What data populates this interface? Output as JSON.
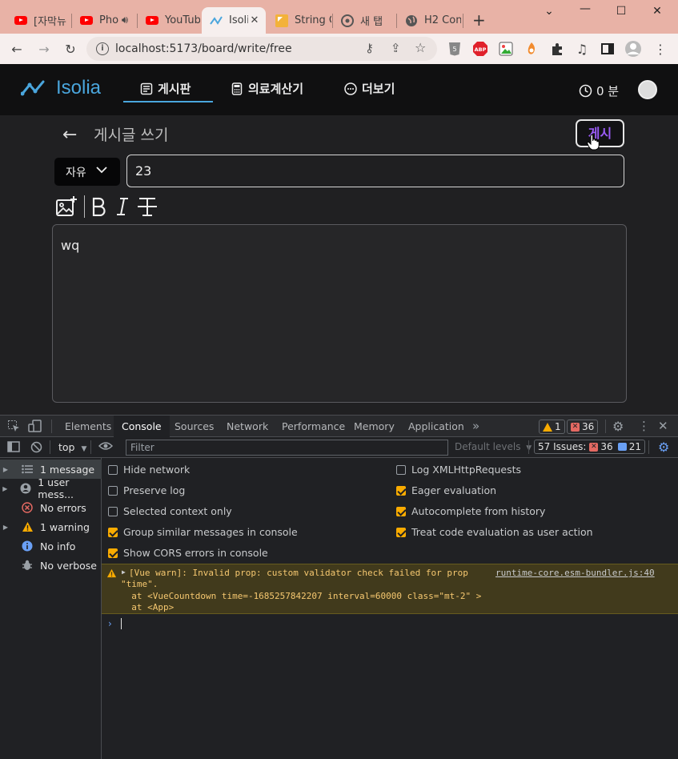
{
  "browser": {
    "tabs": [
      {
        "title": "[자막뉴",
        "icon": "youtube-icon",
        "audio": false
      },
      {
        "title": "Pho",
        "icon": "youtube-icon",
        "audio": true
      },
      {
        "title": "YouTub",
        "icon": "youtube-icon",
        "audio": false
      },
      {
        "title": "Isoli",
        "icon": "isolia-icon",
        "audio": false
      },
      {
        "title": "String C",
        "icon": "kotlin-icon",
        "audio": false
      },
      {
        "title": "새 탭",
        "icon": "chrome-icon",
        "audio": false
      },
      {
        "title": "H2 Con",
        "icon": "globe-icon",
        "audio": false
      }
    ],
    "new_tab": "+",
    "url": "localhost:5173/board/write/free"
  },
  "app": {
    "brand": "Isolia",
    "nav": [
      {
        "label": "게시판",
        "icon": "board-icon",
        "active": true
      },
      {
        "label": "의료계산기",
        "icon": "calculator-icon",
        "active": false
      },
      {
        "label": "더보기",
        "icon": "more-icon",
        "active": false
      }
    ],
    "timer": "0 분",
    "compose": {
      "title": "게시글 쓰기",
      "post_button": "게시",
      "category": "자유",
      "post_title": "23",
      "body": "wq"
    }
  },
  "devtools": {
    "tabs": [
      "Elements",
      "Console",
      "Sources",
      "Network",
      "Performance",
      "Memory",
      "Application"
    ],
    "selected_tab": "Console",
    "warning_count": "1",
    "error_count": "36",
    "context": "top",
    "filter_placeholder": "Filter",
    "levels": "Default levels",
    "issues_label": "57 Issues:",
    "issues_errors": "36",
    "issues_info": "21",
    "sidebar": [
      {
        "label": "1 message",
        "icon": "list-icon",
        "expandable": true
      },
      {
        "label": "1 user mess...",
        "icon": "user-icon",
        "expandable": true
      },
      {
        "label": "No errors",
        "icon": "error-icon",
        "expandable": false
      },
      {
        "label": "1 warning",
        "icon": "warning-icon",
        "expandable": true
      },
      {
        "label": "No info",
        "icon": "info-icon",
        "expandable": false
      },
      {
        "label": "No verbose",
        "icon": "verbose-icon",
        "expandable": false
      }
    ],
    "settings_left": [
      {
        "label": "Hide network",
        "checked": false
      },
      {
        "label": "Preserve log",
        "checked": false
      },
      {
        "label": "Selected context only",
        "checked": false
      },
      {
        "label": "Group similar messages in console",
        "checked": true
      },
      {
        "label": "Show CORS errors in console",
        "checked": true
      }
    ],
    "settings_right": [
      {
        "label": "Log XMLHttpRequests",
        "checked": false
      },
      {
        "label": "Eager evaluation",
        "checked": true
      },
      {
        "label": "Autocomplete from history",
        "checked": true
      },
      {
        "label": "Treat code evaluation as user action",
        "checked": true
      }
    ],
    "warning": {
      "line1": "[Vue warn]: Invalid prop: custom validator check failed for prop",
      "line2": "\"time\".",
      "line3": "  at <VueCountdown time=-1685257842207 interval=60000 class=\"mt-2\" >",
      "line4": "  at <App>",
      "source": "runtime-core.esm-bundler.js:40"
    },
    "prompt": "›"
  },
  "colors": {
    "tabstrip": "#e8b2a6",
    "toolbar": "#f6efee",
    "brand": "#4aa6dd",
    "post_button_text": "#9a5cf5",
    "warning_bg": "#413a1c"
  }
}
